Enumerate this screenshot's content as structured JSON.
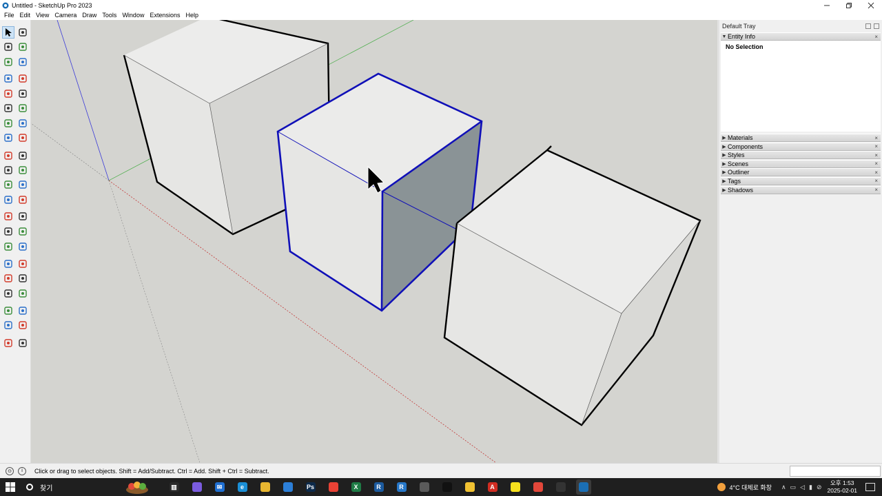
{
  "window": {
    "title": "Untitled - SketchUp Pro 2023",
    "controls": [
      "minimize",
      "restore",
      "close"
    ]
  },
  "menu": [
    "File",
    "Edit",
    "View",
    "Camera",
    "Draw",
    "Tools",
    "Window",
    "Extensions",
    "Help"
  ],
  "toolbar": {
    "tools": [
      {
        "name": "select",
        "active": true
      },
      {
        "name": "lasso-select"
      },
      {
        "name": "paint-bucket"
      },
      {
        "name": "eraser"
      },
      {
        "name": "make-component"
      },
      {
        "name": "tag-eraser"
      },
      {
        "name": "line"
      },
      {
        "name": "freehand"
      },
      {
        "name": "rectangle"
      },
      {
        "name": "rotated-rectangle"
      },
      {
        "name": "circle"
      },
      {
        "name": "polygon"
      },
      {
        "name": "arc"
      },
      {
        "name": "2-point-arc"
      },
      {
        "name": "3-point-arc"
      },
      {
        "name": "pie"
      },
      {
        "name": "move"
      },
      {
        "name": "push-pull"
      },
      {
        "name": "rotate"
      },
      {
        "name": "follow-me"
      },
      {
        "name": "scale"
      },
      {
        "name": "offset"
      },
      {
        "name": "tape-measure"
      },
      {
        "name": "protractor"
      },
      {
        "name": "dimension"
      },
      {
        "name": "text"
      },
      {
        "name": "axes"
      },
      {
        "name": "3d-text"
      },
      {
        "name": "section-plane"
      },
      {
        "name": "orbit"
      },
      {
        "name": "pan"
      },
      {
        "name": "zoom"
      },
      {
        "name": "zoom-window"
      },
      {
        "name": "zoom-extents"
      },
      {
        "name": "position-camera"
      },
      {
        "name": "walk"
      },
      {
        "name": "look-around"
      },
      {
        "name": "section-fill"
      },
      {
        "name": "solid-tools"
      },
      {
        "name": "sandbox"
      },
      {
        "name": "stamp"
      },
      {
        "name": "drape"
      }
    ]
  },
  "tray": {
    "title": "Default Tray",
    "entity_info": {
      "label": "Entity Info",
      "selection": "No Selection"
    },
    "panels": [
      "Materials",
      "Components",
      "Styles",
      "Scenes",
      "Outliner",
      "Tags",
      "Shadows"
    ]
  },
  "status": {
    "text": "Click or drag to select objects. Shift = Add/Subtract. Ctrl = Add. Shift + Ctrl = Subtract.",
    "measurement": ""
  },
  "taskbar": {
    "search_placeholder": "찾기",
    "apps": [
      {
        "name": "task-view",
        "color": "#2a2a2a",
        "glyph": "▥"
      },
      {
        "name": "copilot",
        "color": "#7b5ce0",
        "glyph": ""
      },
      {
        "name": "mail",
        "color": "#1f6fd1",
        "glyph": "✉"
      },
      {
        "name": "edge",
        "color": "#1b8fd6",
        "glyph": "e"
      },
      {
        "name": "file-explorer",
        "color": "#e8b630",
        "glyph": ""
      },
      {
        "name": "store",
        "color": "#2c7fd8",
        "glyph": ""
      },
      {
        "name": "photoshop",
        "color": "#0d2a4a",
        "glyph": "Ps"
      },
      {
        "name": "chrome",
        "color": "#e94235",
        "glyph": ""
      },
      {
        "name": "excel",
        "color": "#1e7b45",
        "glyph": "X"
      },
      {
        "name": "revit",
        "color": "#1b5a9e",
        "glyph": "R"
      },
      {
        "name": "revit-2",
        "color": "#2677c8",
        "glyph": "R"
      },
      {
        "name": "app-cloud",
        "color": "#5a5a5a",
        "glyph": ""
      },
      {
        "name": "app-black",
        "color": "#111111",
        "glyph": ""
      },
      {
        "name": "notes",
        "color": "#f1c232",
        "glyph": ""
      },
      {
        "name": "acrobat",
        "color": "#d12d22",
        "glyph": "A"
      },
      {
        "name": "kakaotalk",
        "color": "#f7e01d",
        "glyph": ""
      },
      {
        "name": "app-red",
        "color": "#e2473a",
        "glyph": ""
      },
      {
        "name": "recorder",
        "color": "#333333",
        "glyph": ""
      },
      {
        "name": "sketchup",
        "color": "#1b6fb5",
        "glyph": ""
      }
    ],
    "weather": "4°C  대체로 화창",
    "time": "오후 1:53",
    "date": "2025-02-01"
  }
}
